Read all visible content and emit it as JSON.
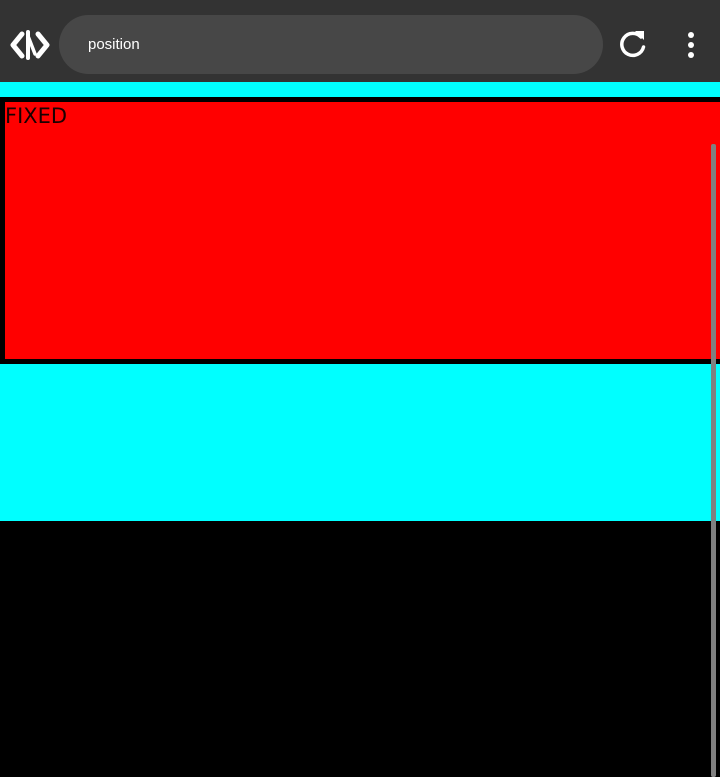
{
  "browser": {
    "app_icon": "code-brackets-icon",
    "url": "position",
    "reload_icon": "reload-icon",
    "menu_icon": "more-vertical-icon"
  },
  "page": {
    "fixed_label": "FIXED",
    "colors": {
      "background": "#000000",
      "band": "#00ffff",
      "fixed_box": "#ff0000",
      "fixed_border": "#000000"
    }
  }
}
